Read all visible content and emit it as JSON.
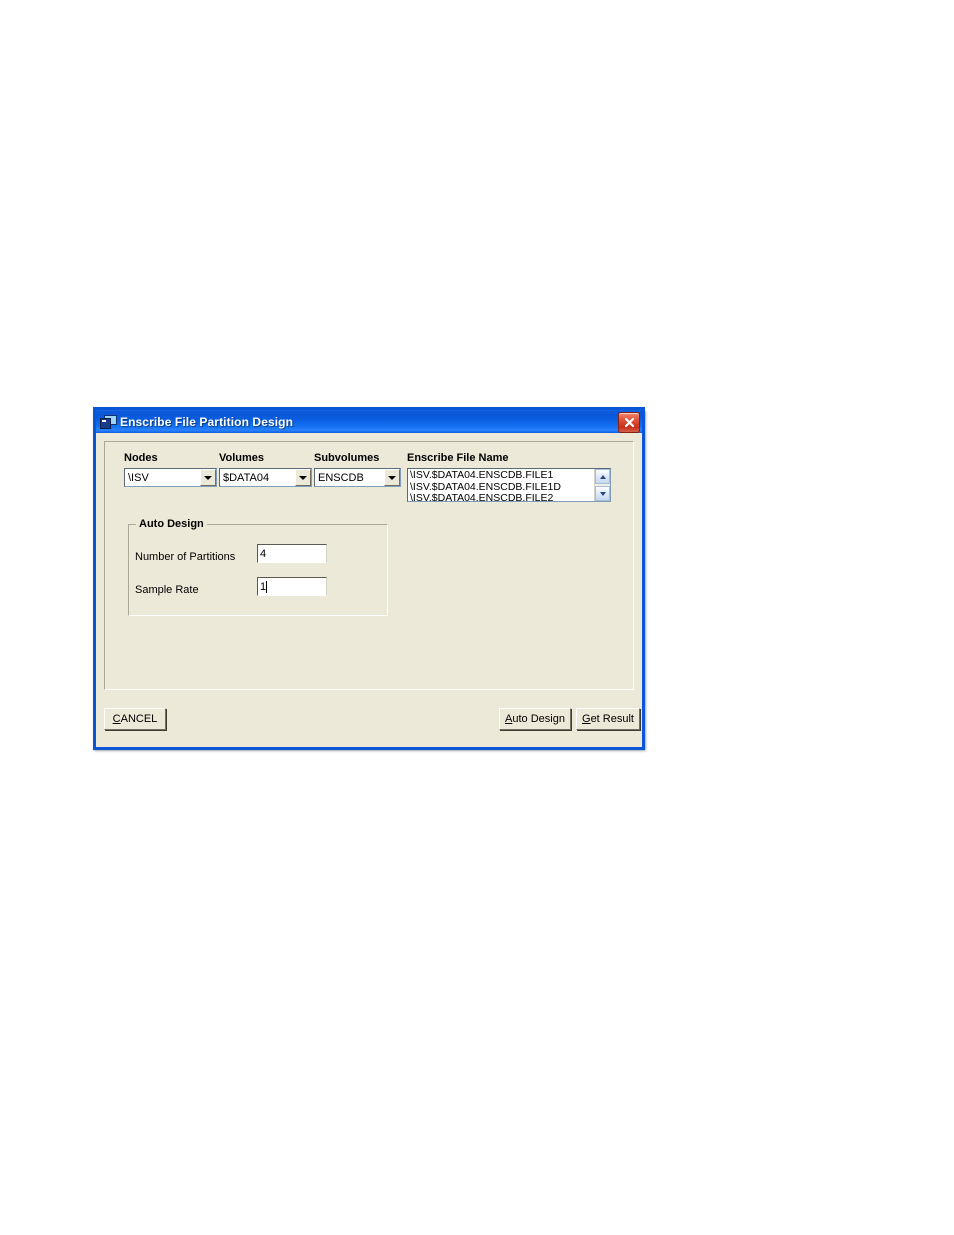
{
  "window": {
    "title": "Enscribe File Partition Design",
    "icon": "application-window-icon",
    "close_label": "×",
    "titlebar_color": "#0a56d6",
    "face_color": "#ece9d8",
    "close_color": "#c5301b"
  },
  "fields": {
    "nodes": {
      "label": "Nodes",
      "value": "\\ISV"
    },
    "volumes": {
      "label": "Volumes",
      "value": "$DATA04"
    },
    "subvolumes": {
      "label": "Subvolumes",
      "value": "ENSCDB"
    },
    "file_name": {
      "label": "Enscribe File Name",
      "items": [
        "\\ISV.$DATA04.ENSCDB.FILE1",
        "\\ISV.$DATA04.ENSCDB.FILE1D",
        "\\ISV.$DATA04.ENSCDB.FILE2"
      ]
    }
  },
  "auto_design": {
    "title": "Auto Design",
    "number_of_partitions": {
      "label": "Number of Partitions",
      "value": "4"
    },
    "sample_rate": {
      "label": "Sample Rate",
      "value": "1"
    }
  },
  "buttons": {
    "cancel": {
      "pre": "",
      "accel": "C",
      "post": "ANCEL"
    },
    "auto_design": {
      "pre": "",
      "accel": "A",
      "post": "uto Design"
    },
    "get_result": {
      "pre": "",
      "accel": "G",
      "post": "et Result"
    }
  }
}
